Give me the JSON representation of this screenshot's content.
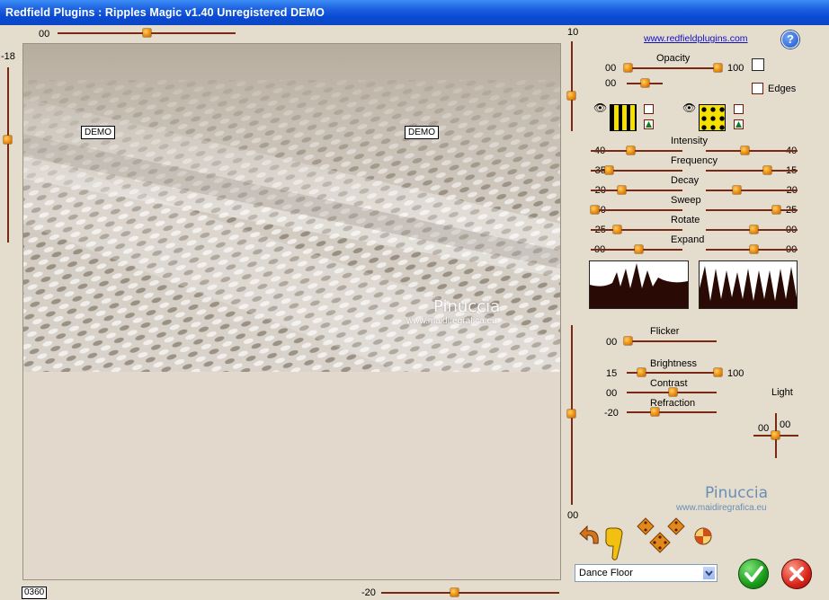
{
  "window": {
    "title": "Redfield Plugins : Ripples Magic v1.40   Unregistered  DEMO"
  },
  "top_slider": {
    "value": "00"
  },
  "left_slider": {
    "value": "-18"
  },
  "right_slider": {
    "top_value": "10",
    "bottom_value": "00"
  },
  "bottom_slider": {
    "value": "-20"
  },
  "preview": {
    "demo_label": "DEMO",
    "watermark_name": "Pinuccia",
    "watermark_url": "www.maidiregrafica.eu"
  },
  "counter": {
    "value": "0360"
  },
  "link": {
    "text": "www.redfieldplugins.com"
  },
  "help": {
    "label": "?"
  },
  "opacity": {
    "label": "Opacity",
    "min": "00",
    "max": "100",
    "second_value": "00"
  },
  "edges": {
    "label": "Edges"
  },
  "params": [
    {
      "label": "Intensity",
      "left": "40",
      "right": "40"
    },
    {
      "label": "Frequency",
      "left": "-35",
      "right": "15"
    },
    {
      "label": "Decay",
      "left": "-20",
      "right": "-20"
    },
    {
      "label": "Sweep",
      "left": "-50",
      "right": "25"
    },
    {
      "label": "Rotate",
      "left": "-25",
      "right": "00"
    },
    {
      "label": "Expand",
      "left": "00",
      "right": "00"
    }
  ],
  "lighting": {
    "flicker_label": "Flicker",
    "flicker_value": "00",
    "brightness_label": "Brightness",
    "brightness_min": "15",
    "brightness_max": "100",
    "contrast_label": "Contrast",
    "contrast_value": "00",
    "refraction_label": "Refraction",
    "refraction_value": "-20",
    "light_label": "Light",
    "light_x": "00",
    "light_y": "00"
  },
  "watermark2": {
    "name": "Pinuccia",
    "url": "www.maidiregrafica.eu"
  },
  "preset": {
    "selected": "Dance Floor"
  },
  "colors": {
    "titlebar": "#0b4fd8",
    "background": "#e4dccd",
    "track": "#7a2a14",
    "thumb": "#f09a1a"
  }
}
